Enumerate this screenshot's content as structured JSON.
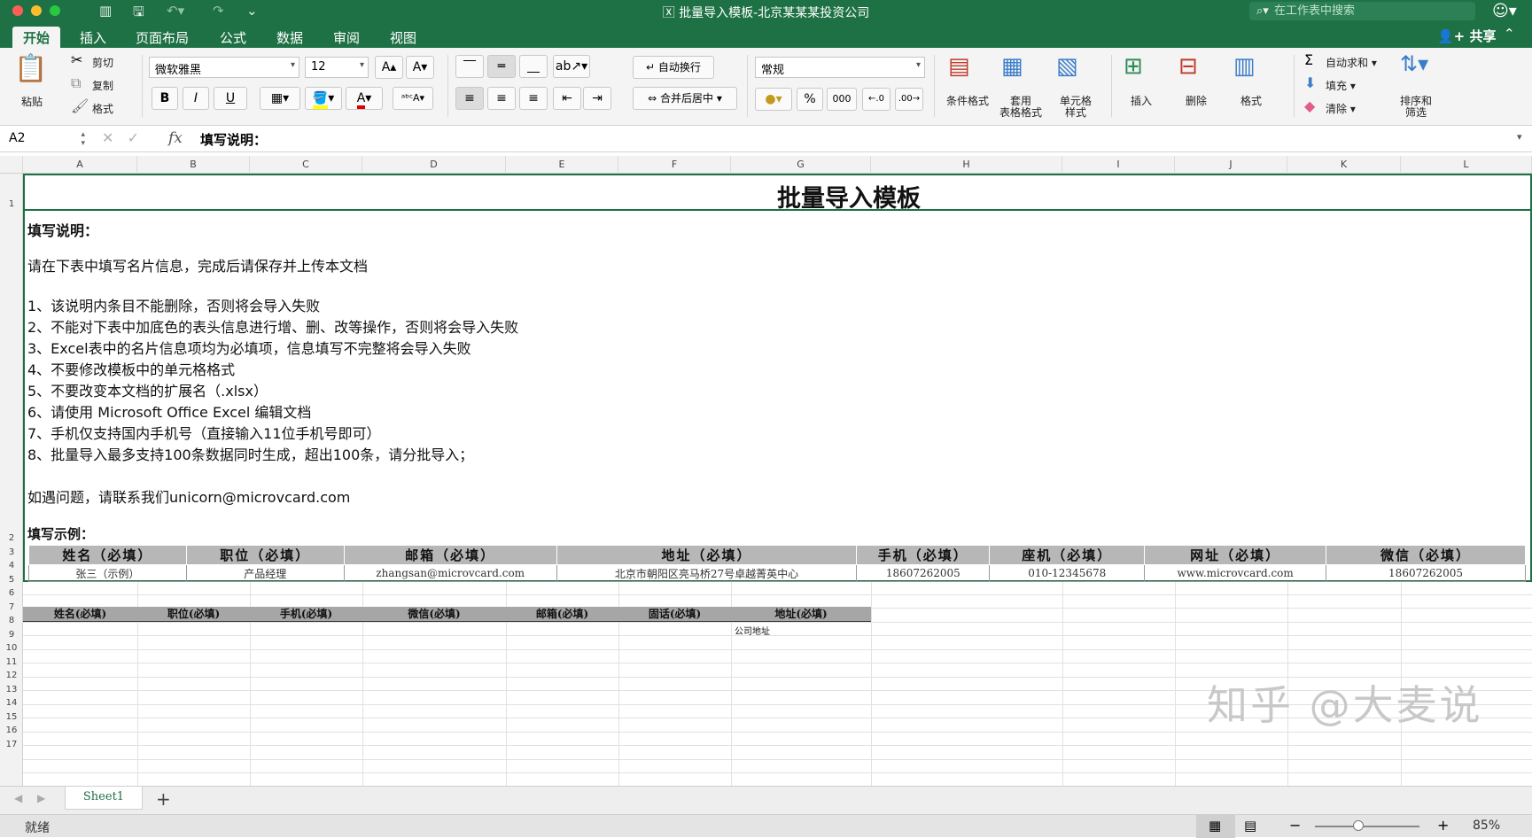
{
  "window": {
    "title": "批量导入模板-北京某某某投资公司",
    "search_placeholder": "在工作表中搜索"
  },
  "tabs": [
    "开始",
    "插入",
    "页面布局",
    "公式",
    "数据",
    "审阅",
    "视图"
  ],
  "share_label": "共享",
  "ribbon": {
    "paste": "粘贴",
    "cut": "剪切",
    "copy": "复制",
    "format_painter": "格式",
    "font_name": "微软雅黑",
    "font_size": "12",
    "bold": "B",
    "italic": "I",
    "underline": "U",
    "wrap_text": "自动换行",
    "merge_center": "合并后居中",
    "number_format": "常规",
    "percent": "%",
    "thousands": "000",
    "cond_format": "条件格式",
    "table_format_1": "套用",
    "table_format_2": "表格格式",
    "cell_style_1": "单元格",
    "cell_style_2": "样式",
    "insert": "插入",
    "delete": "删除",
    "format": "格式",
    "autosum": "自动求和",
    "fill": "填充",
    "clear": "清除",
    "sort_filter_1": "排序和",
    "sort_filter_2": "筛选"
  },
  "formula_bar": {
    "name_box": "A2",
    "fx": "fx",
    "content": "填写说明："
  },
  "columns": [
    "A",
    "B",
    "C",
    "D",
    "E",
    "F",
    "G",
    "H",
    "I",
    "J",
    "K",
    "L"
  ],
  "rows": [
    "1",
    "2",
    "3",
    "4",
    "5",
    "6",
    "7",
    "8",
    "9",
    "10",
    "11",
    "12",
    "13",
    "14",
    "15",
    "16",
    "17"
  ],
  "sheet": {
    "title": "批量导入模板",
    "instructions_heading": "填写说明：",
    "intro": "请在下表中填写名片信息，完成后请保存并上传本文档",
    "rules": [
      "1、该说明内条目不能删除，否则将会导入失败",
      "2、不能对下表中加底色的表头信息进行增、删、改等操作，否则将会导入失败",
      "3、Excel表中的名片信息项均为必填项，信息填写不完整将会导入失败",
      "4、不要修改模板中的单元格格式",
      "5、不要改变本文档的扩展名（.xlsx）",
      "6、请使用 Microsoft Office Excel 编辑文档",
      "7、手机仅支持国内手机号（直接输入11位手机号即可）",
      "8、批量导入最多支持100条数据同时生成，超出100条，请分批导入；"
    ],
    "contact": "如遇问题，请联系我们unicorn@microvcard.com",
    "example_heading": "填写示例：",
    "example_headers": [
      "姓名（必填）",
      "职位（必填）",
      "邮箱（必填）",
      "地址（必填）",
      "手机（必填）",
      "座机（必填）",
      "网址（必填）",
      "微信（必填）"
    ],
    "example_row": [
      "张三（示例）",
      "产品经理",
      "zhangsan@microvcard.com",
      "北京市朝阳区亮马桥27号卓越菁英中心",
      "18607262005",
      "010-12345678",
      "www.microvcard.com",
      "18607262005"
    ],
    "data_headers": [
      "姓名(必填)",
      "职位(必填)",
      "手机(必填)",
      "微信(必填)",
      "邮箱(必填)",
      "固话(必填)",
      "地址(必填)"
    ],
    "row6_address": "公司地址"
  },
  "watermark": "知乎 @大麦说",
  "sheet_tab": "Sheet1",
  "status": {
    "ready": "就绪",
    "zoom": "85%",
    "zoom_fraction": 0.85
  },
  "colors": {
    "excel_green": "#1e7145",
    "header_gray": "#b7b7b7"
  }
}
